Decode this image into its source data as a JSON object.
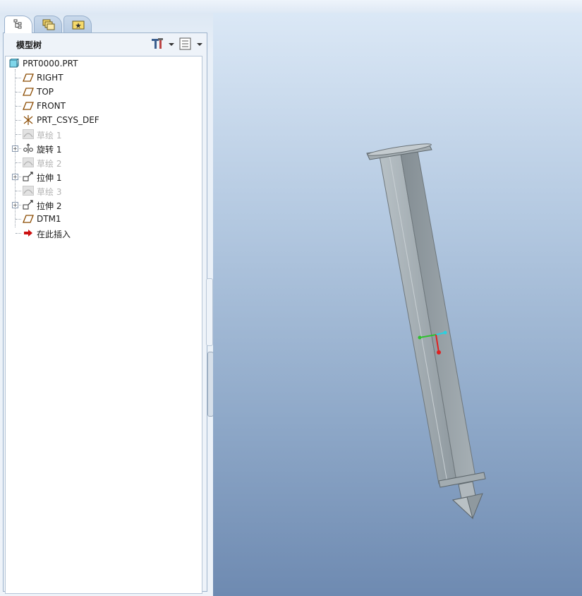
{
  "panel": {
    "title": "模型树",
    "tabs": [
      {
        "icon": "model-tree-icon",
        "active": true
      },
      {
        "icon": "folder-browser-icon",
        "active": false
      },
      {
        "icon": "favorites-icon",
        "active": false
      }
    ],
    "settings_icon": "tools-settings-icon",
    "show_icon": "show-list-icon"
  },
  "tree": {
    "root": {
      "label": "PRT0000.PRT",
      "icon": "part-icon"
    },
    "items": [
      {
        "label": "RIGHT",
        "icon": "datum-plane-icon",
        "dim": false,
        "expandable": false
      },
      {
        "label": "TOP",
        "icon": "datum-plane-icon",
        "dim": false,
        "expandable": false
      },
      {
        "label": "FRONT",
        "icon": "datum-plane-icon",
        "dim": false,
        "expandable": false
      },
      {
        "label": "PRT_CSYS_DEF",
        "icon": "csys-icon",
        "dim": false,
        "expandable": false
      },
      {
        "label": "草绘 1",
        "icon": "sketch-icon",
        "dim": true,
        "expandable": false
      },
      {
        "label": "旋转 1",
        "icon": "revolve-icon",
        "dim": false,
        "expandable": true
      },
      {
        "label": "草绘 2",
        "icon": "sketch-icon",
        "dim": true,
        "expandable": false
      },
      {
        "label": "拉伸 1",
        "icon": "extrude-icon",
        "dim": false,
        "expandable": true
      },
      {
        "label": "草绘 3",
        "icon": "sketch-icon",
        "dim": true,
        "expandable": false
      },
      {
        "label": "拉伸 2",
        "icon": "extrude-icon",
        "dim": false,
        "expandable": true
      },
      {
        "label": "DTM1",
        "icon": "datum-plane-icon",
        "dim": false,
        "expandable": false
      },
      {
        "label": "在此插入",
        "icon": "insert-here-arrow-icon",
        "dim": false,
        "expandable": false
      }
    ]
  },
  "colors": {
    "viewport_top": "#dbe8f6",
    "viewport_bottom": "#6e8ab1",
    "part": "#9aa3a8",
    "insert_arrow": "#cc1010"
  }
}
